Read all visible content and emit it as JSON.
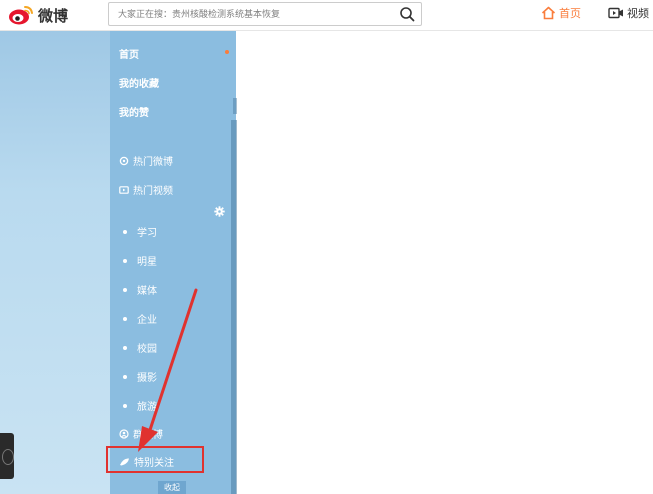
{
  "header": {
    "logo_text": "微博",
    "search_placeholder": "大家正在搜：贵州核酸检测系统基本恢复",
    "nav_home": "首页",
    "nav_video": "视频"
  },
  "sidebar": {
    "items": [
      {
        "label": "首页"
      },
      {
        "label": "我的收藏"
      },
      {
        "label": "我的赞"
      },
      {
        "label": "热门微博"
      },
      {
        "label": "热门视频"
      },
      {
        "label": "学习"
      },
      {
        "label": "明星"
      },
      {
        "label": "媒体"
      },
      {
        "label": "企业"
      },
      {
        "label": "校园"
      },
      {
        "label": "摄影"
      },
      {
        "label": "旅游"
      },
      {
        "label": "群微博"
      },
      {
        "label": "特别关注"
      }
    ],
    "collapse_label": "收起"
  },
  "colors": {
    "sidebar_bg": "#8bbde0",
    "accent_orange": "#fa7d3c",
    "highlight_red": "#e0322f"
  }
}
